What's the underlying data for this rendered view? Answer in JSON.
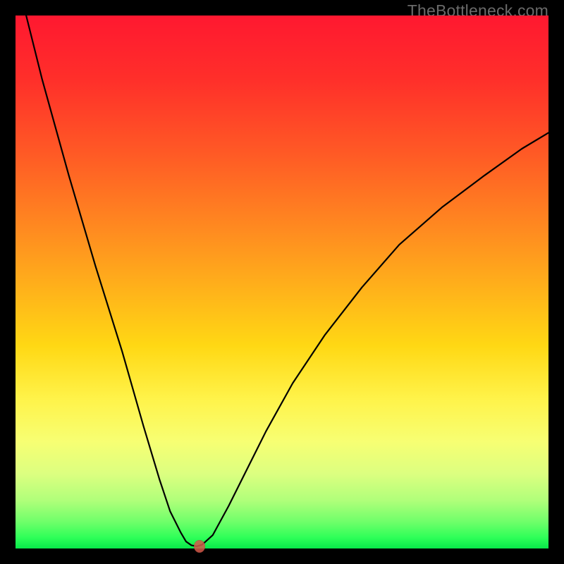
{
  "watermark": "TheBottleneck.com",
  "chart_data": {
    "type": "line",
    "title": "",
    "xlabel": "",
    "ylabel": "",
    "xlim": [
      0,
      100
    ],
    "ylim": [
      0,
      100
    ],
    "grid": false,
    "series": [
      {
        "name": "bottleneck-curve",
        "x": [
          2,
          5,
          10,
          15,
          20,
          24,
          27,
          29,
          31,
          32,
          33,
          34,
          35,
          37,
          40,
          43,
          47,
          52,
          58,
          65,
          72,
          80,
          88,
          95,
          100
        ],
        "values": [
          100,
          88,
          70,
          53,
          37,
          23,
          13,
          7,
          3,
          1.3,
          0.6,
          0.4,
          0.7,
          2.5,
          8,
          14,
          22,
          31,
          40,
          49,
          57,
          64,
          70,
          75,
          78
        ]
      }
    ],
    "marker": {
      "x": 34.5,
      "y": 0.4
    },
    "background": {
      "type": "vertical-gradient",
      "stops": [
        {
          "pos": 0,
          "color": "#ff1830"
        },
        {
          "pos": 40,
          "color": "#ff8a20"
        },
        {
          "pos": 72,
          "color": "#fff34a"
        },
        {
          "pos": 100,
          "color": "#08e84a"
        }
      ]
    }
  }
}
